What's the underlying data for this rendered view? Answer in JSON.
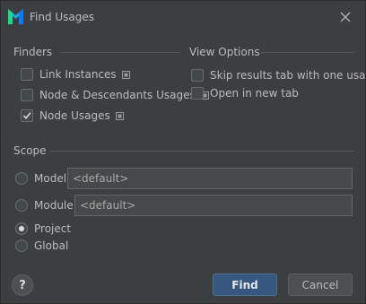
{
  "window": {
    "title": "Find Usages",
    "app_icon": "mps-logo-icon",
    "close_icon": "close-icon"
  },
  "finders": {
    "heading": "Finders",
    "items": [
      {
        "label": "Link Instances",
        "checked": false,
        "has_options": true
      },
      {
        "label": "Node & Descendants Usages",
        "checked": false,
        "has_options": true
      },
      {
        "label": "Node Usages",
        "checked": true,
        "has_options": true
      }
    ]
  },
  "view_options": {
    "heading": "View Options",
    "items": [
      {
        "label": "Skip results tab with one usage",
        "checked": false
      },
      {
        "label": "Open in new tab",
        "checked": false
      }
    ]
  },
  "scope": {
    "heading": "Scope",
    "options": [
      {
        "label": "Model",
        "selected": false,
        "input_value": "<default>"
      },
      {
        "label": "Module",
        "selected": false,
        "input_value": "<default>"
      },
      {
        "label": "Project",
        "selected": true
      },
      {
        "label": "Global",
        "selected": false
      }
    ]
  },
  "buttons": {
    "help": "?",
    "find": "Find",
    "cancel": "Cancel"
  },
  "colors": {
    "background": "#3c3f41",
    "text": "#bbbbbb",
    "primary_button": "#365880",
    "logo_blue": "#1fa6e0",
    "logo_green": "#21d789"
  }
}
